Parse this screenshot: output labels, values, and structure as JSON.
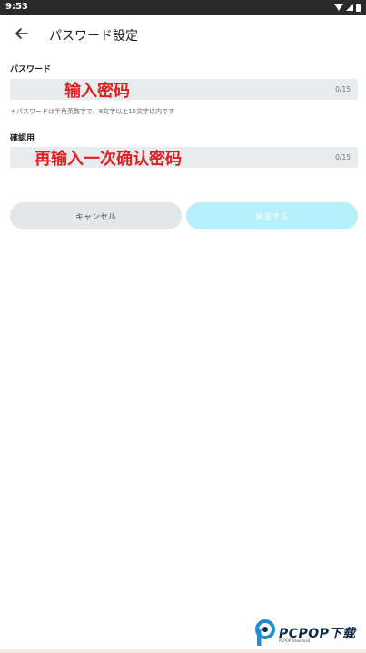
{
  "status_bar": {
    "time": "9:53",
    "icons": [
      "wifi-icon",
      "signal-icon",
      "battery-icon"
    ]
  },
  "app_bar": {
    "back_icon": "arrow-left-icon",
    "title": "パスワード設定"
  },
  "password_field": {
    "label": "パスワード",
    "value": "",
    "counter": "0/15",
    "annotation": "输入密码",
    "hint": "＊パスワードは半角英数字で、8文字以上15文字以内です"
  },
  "confirm_field": {
    "label": "確認用",
    "value": "",
    "counter": "0/15",
    "annotation": "再输入一次确认密码"
  },
  "buttons": {
    "cancel": "キャンセル",
    "submit": "設定する"
  },
  "watermark": {
    "brand": "PCPOP下载",
    "sub": "PCPOP Download"
  },
  "colors": {
    "annotation": "#e02020",
    "submit_button": "#b6f0fa",
    "field_bg": "#e9ecee",
    "cancel_button": "#e4e7ea"
  }
}
